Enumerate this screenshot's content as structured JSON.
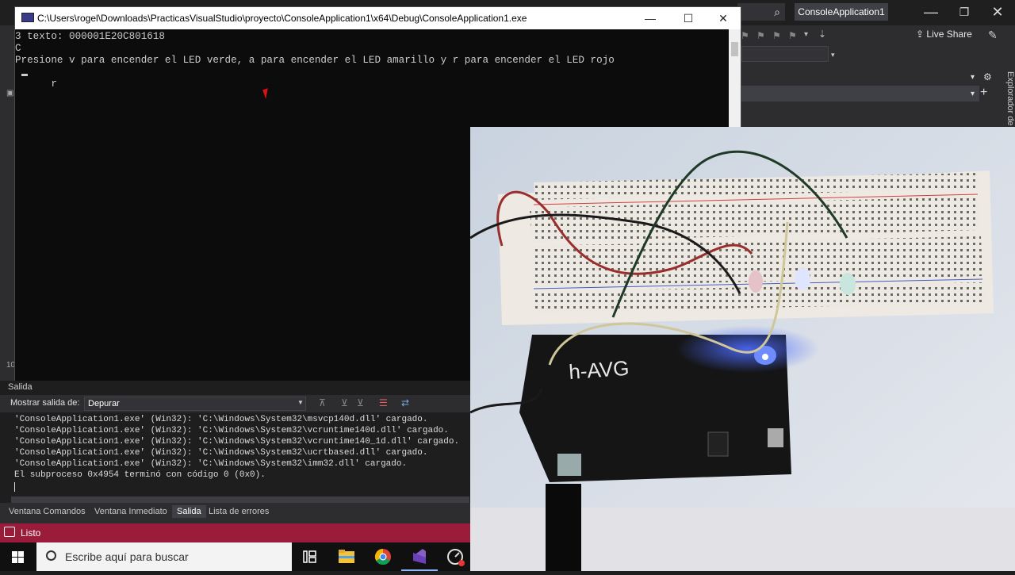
{
  "console": {
    "title": "C:\\Users\\rogel\\Downloads\\PracticasVisualStudio\\proyecto\\ConsoleApplication1\\x64\\Debug\\ConsoleApplication1.exe",
    "lines": [
      "3 texto: 000001E20C801618",
      "C",
      "Presione v para encender el LED verde, a para encender el LED amarillo y r para encender el LED rojo",
      "r"
    ],
    "controls": {
      "minimize": "—",
      "maximize": "☐",
      "close": "✕"
    }
  },
  "vs": {
    "solution_name": "ConsoleApplication1",
    "live_share": "Live Share",
    "side_tab": "Explorador de",
    "output": {
      "panel_title": "Salida",
      "show_output_from_label": "Mostrar salida de:",
      "source_selected": "Depurar",
      "lines": [
        "'ConsoleApplication1.exe' (Win32): 'C:\\Windows\\System32\\msvcp140d.dll' cargado.",
        "'ConsoleApplication1.exe' (Win32): 'C:\\Windows\\System32\\vcruntime140d.dll' cargado.",
        "'ConsoleApplication1.exe' (Win32): 'C:\\Windows\\System32\\vcruntime140_1d.dll' cargado.",
        "'ConsoleApplication1.exe' (Win32): 'C:\\Windows\\System32\\ucrtbased.dll' cargado.",
        "'ConsoleApplication1.exe' (Win32): 'C:\\Windows\\System32\\imm32.dll' cargado.",
        "El subproceso 0x4954 terminó con código 0 (0x0)."
      ]
    },
    "bottom_tabs": [
      "Ventana Comandos",
      "Ventana Inmediato",
      "Salida",
      "Lista de errores"
    ],
    "status": "Listo",
    "left_stub": "10"
  },
  "taskbar": {
    "search_placeholder": "Escribe aquí para buscar",
    "apps": [
      "task-view-icon",
      "file-explorer-icon",
      "chrome-icon",
      "visual-studio-icon",
      "recorder-icon"
    ]
  },
  "photo": {
    "board_label": "h-AVG",
    "leds": [
      "red",
      "white",
      "green"
    ]
  },
  "colors": {
    "status_bar": "#9b1c3a",
    "vs_bg": "#2d2d30",
    "console_bg": "#0c0c0c"
  }
}
